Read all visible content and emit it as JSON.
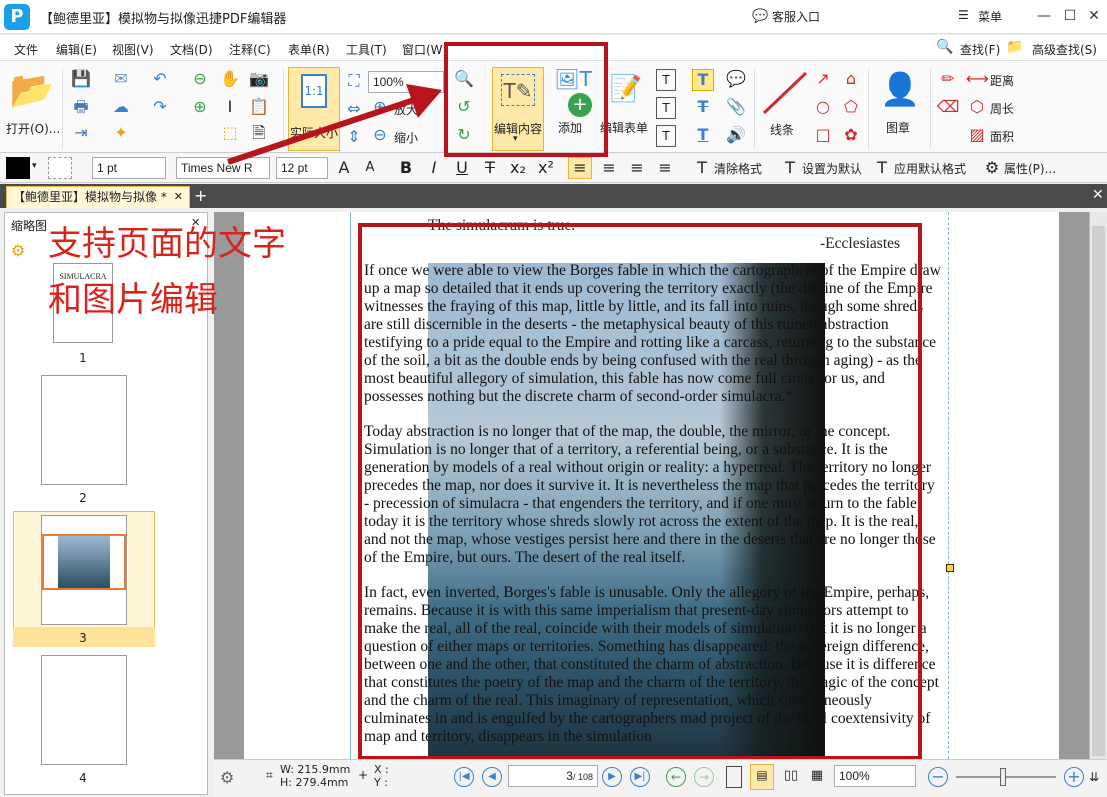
{
  "window": {
    "title": "【鲍德里亚】模拟物与拟像迅捷PDF编辑器",
    "support": "客服入口",
    "menu": "菜单"
  },
  "menubar": [
    "文件",
    "编辑(E)",
    "视图(V)",
    "文档(D)",
    "注释(C)",
    "表单(R)",
    "工具(T)",
    "窗口(W)"
  ],
  "search": {
    "find": "查找(F)",
    "advanced": "高级查找(S)"
  },
  "ribbon": {
    "open": "打开(O)...",
    "actual_size": "实际大小",
    "zoom": "100%",
    "zoom_in": "放大",
    "zoom_out": "缩小",
    "edit_content": "编辑内容",
    "add": "添加",
    "edit_form": "编辑表单",
    "line": "线条",
    "stamp": "图章",
    "distance": "距离",
    "perimeter": "周长",
    "area": "面积"
  },
  "format": {
    "line_width": "1 pt",
    "font": "Times New R",
    "font_size": "12 pt",
    "clear_format": "清除格式",
    "set_default": "设置为默认",
    "apply_default": "应用默认格式",
    "properties": "属性(P)..."
  },
  "tab": {
    "name": "【鲍德里亚】模拟物与拟像 *"
  },
  "sidebar": {
    "title": "缩略图",
    "pages": [
      "1",
      "2",
      "3",
      "4"
    ],
    "thumb1_title": "SIMULACRA",
    "active_page": 3
  },
  "annotation": {
    "line1": "支持页面的文字",
    "line2": "和图片编辑"
  },
  "document": {
    "epigraph": "The simulacrum is true.",
    "attribution": "-Ecclesiastes",
    "paragraphs": [
      "If once we were able to view the Borges fable in which the cartographers of the Empire draw up a map so detailed that it ends up covering the territory exactly (the decline of the Empire witnesses the fraying of this map, little by little, and its fall into ruins, though some shreds are still discernible in the deserts - the metaphysical beauty of this ruined abstraction testifying to a pride equal to the Empire and rotting like a carcass, returning to the substance of the soil, a bit as the double ends by being confused with the real through aging) - as the most beautiful allegory of simulation, this fable has now come full circle for us, and possesses nothing but the discrete charm of second-order simulacra.*",
      "Today abstraction is no longer that of the map, the double, the mirror, or the concept. Simulation is no longer that of a territory, a referential being, or a substance. It is the generation by models of a real without origin or reality: a hyperreal. The territory no longer precedes the map, nor does it survive it. It is nevertheless the map that precedes the territory - precession of simulacra - that engenders the territory, and if one must return to the fable, today it is the territory whose shreds slowly rot across the extent of the map. It is the real, and not the map, whose vestiges persist here and there in the deserts that are no longer those of the Empire, but ours. The desert of the real itself.",
      "In fact, even inverted, Borges's fable is unusable. Only the allegory of the Empire, perhaps, remains. Because it is with this same imperialism that present-day simulators attempt to make the real, all of the real, coincide with their models of simulation. But it is no longer a question of either maps or territories. Something has disappeared: the sovereign difference, between one and the other, that constituted the charm of abstraction. Because it is difference that constitutes the poetry of the map and the charm of the territory, the magic of the concept and the charm of the real. This imaginary of representation, which simultaneously culminates in and is engulfed by the cartographers mad project of the ideal coextensivity of map and territory, disappears in the simulation"
    ]
  },
  "status": {
    "width": "W: 215.9mm",
    "height": "H: 279.4mm",
    "x": "X :",
    "y": "Y :",
    "page_current": "3",
    "page_total": "/ 108",
    "zoom": "100%"
  },
  "colors": {
    "annotation_red": "#d9231d",
    "box_red": "#b8141b",
    "accent_blue": "#1aa0e8"
  }
}
